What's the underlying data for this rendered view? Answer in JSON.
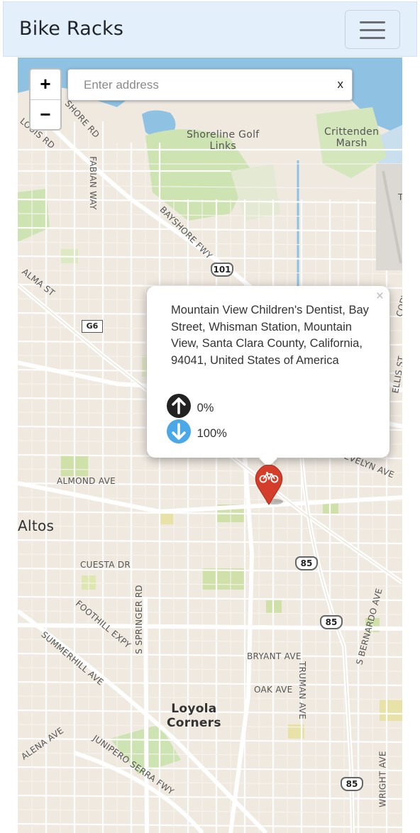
{
  "navbar": {
    "brand": "Bike Racks"
  },
  "search": {
    "placeholder": "Enter address",
    "clear_label": "x"
  },
  "zoom": {
    "in_label": "+",
    "out_label": "−"
  },
  "popup": {
    "close_label": "×",
    "address": "Mountain View Children's Dentist, Bay Street, Whisman Station, Mountain View, Santa Clara County, California, 94041, United States of America",
    "up_percent": "0%",
    "down_percent": "100%",
    "up_icon": "arrow-up-circle-icon",
    "down_icon": "arrow-down-circle-icon",
    "down_color": "#4aa8e8",
    "up_color": "#222222"
  },
  "marker": {
    "icon": "bicycle-icon",
    "color": "#d43d2a"
  },
  "map_labels": {
    "shoreline": "Shoreline Golf\nLinks",
    "crittenden": "Crittenden\nMarsh",
    "altos": "Altos",
    "loyola": "Loyola\nCorners",
    "almond": "ALMOND AVE",
    "cuesta": "CUESTA DR",
    "bryant": "BRYANT AVE",
    "oak": "OAK AVE",
    "alma": "ALMA ST",
    "bayshore": "BAYSHORE FWY",
    "fabian": "FABIAN WAY",
    "louis": "LOUIS RD",
    "shore_rd": "SHORE RD",
    "springer": "S SPRINGER RD",
    "foothill": "FOOTHILL EXPY",
    "summerhill": "SUMMERHILL AVE",
    "junipero": "JUNIPERO SERRA FWY",
    "alena": "ALENA AVE",
    "truman": "TRUMAN AVE",
    "bernardo": "S BERNARDO AVE",
    "wright": "WRIGHT AVE",
    "evelyn": "EVELYN AVE",
    "ellis": "ELLIS ST",
    "cody": "CODY R",
    "t": "T"
  },
  "shields": {
    "us101": "101",
    "g6": "G6",
    "r85a": "85",
    "r85b": "85",
    "r85c": "85"
  }
}
